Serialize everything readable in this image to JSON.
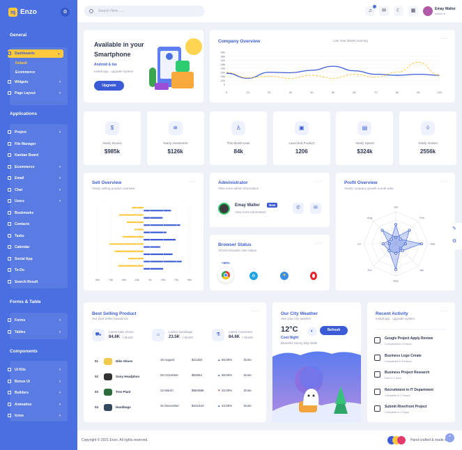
{
  "brand": {
    "mark": "ɱ",
    "name": "Enzo"
  },
  "sidebar": {
    "sections": [
      "General",
      "Applications",
      "Forms & Table",
      "Components"
    ],
    "general": [
      {
        "label": "Dashboards",
        "active": true
      },
      {
        "label": "Widgets"
      },
      {
        "label": "Page Layout"
      }
    ],
    "dash_sub": [
      "Default",
      "Ecommerce"
    ],
    "applications": [
      "Project",
      "File Manager",
      "Kanban Board",
      "Ecommerce",
      "Email",
      "Chat",
      "Users",
      "Bookmarks",
      "Contacts",
      "Tasks",
      "Calendar",
      "Social App",
      "To-Do",
      "Search Result"
    ],
    "forms": [
      "Forms",
      "Tables"
    ],
    "components": [
      "Ui Kits",
      "Bonus Ui",
      "Builders",
      "Animation",
      "Icons"
    ]
  },
  "topbar": {
    "search_placeholder": "Search Here.......",
    "user_name": "Emay Walter",
    "user_role": "Admin ▾"
  },
  "welcome": {
    "title_line1": "Available in your",
    "title_line2": "Smartphone",
    "platforms": "Android & Ios",
    "subtitle": "Install app , upgrade system",
    "button": "Upgrade"
  },
  "company": {
    "title": "Company Overview",
    "legend": "Last Year $300K Earning",
    "more": "···"
  },
  "stats": [
    {
      "label": "Yearly Invoice",
      "value": "$985k",
      "icon": "dollar-icon",
      "glyph": "$"
    },
    {
      "label": "Yearly Investment",
      "value": "$126k",
      "icon": "database-icon",
      "glyph": "≋"
    },
    {
      "label": "This Month User",
      "value": "84k",
      "icon": "user-icon",
      "glyph": "♙"
    },
    {
      "label": "Launched Product",
      "value": "1206",
      "icon": "box-icon",
      "glyph": "▣"
    },
    {
      "label": "Yearly Spend",
      "value": "$324k",
      "icon": "document-icon",
      "glyph": "▤"
    },
    {
      "label": "Yearly Visitors",
      "value": "2556k",
      "icon": "drop-icon",
      "glyph": "◊"
    }
  ],
  "sell": {
    "title": "Sell Overview",
    "subtitle": "Yearly selling product overview"
  },
  "admin": {
    "title": "Administrator",
    "subtitle": "View more admin information",
    "name": "Emay Walter",
    "badge": "New",
    "link": "View more information"
  },
  "browser": {
    "title": "Browser Status",
    "subtitle": "All time browser user status",
    "badge": "+50%"
  },
  "profit": {
    "title": "Profit Overview",
    "subtitle": "Yearly company growth month wise"
  },
  "best": {
    "title": "Best Selling Product",
    "subtitle": "Our best Seller Details list",
    "summary": [
      {
        "label": "Latest Nike shoes",
        "value": "84.6K",
        "unit": "/ Month"
      },
      {
        "label": "Ladies handbags",
        "value": "23.5K",
        "unit": "/ Month"
      },
      {
        "label": "Latest Cosmetics",
        "value": "84.6K",
        "unit": "/ Month"
      }
    ],
    "rows": [
      {
        "no": "01",
        "name": "Nike Shoes",
        "date": "16 August",
        "price": "$21326",
        "pct": "65.00%",
        "up": true,
        "status": "Done"
      },
      {
        "no": "02",
        "name": "Sony Headphon",
        "date": "02 Octomber",
        "price": "$54564",
        "pct": "95.00%",
        "up": true,
        "status": "Done"
      },
      {
        "no": "03",
        "name": "Tree Plant",
        "date": "12 March",
        "price": "$884996",
        "pct": "02.00%",
        "up": false,
        "status": "Done"
      },
      {
        "no": "04",
        "name": "Handbags",
        "date": "31 December",
        "price": "$441623",
        "pct": "43.00%",
        "up": true,
        "status": "Done"
      }
    ]
  },
  "weather": {
    "title": "Our City Weather",
    "subtitle": "See your city weather",
    "temp": "12°C",
    "condition": "Cool Night",
    "desc": "Beautiful Sunny Day Walk",
    "refresh": "Refresh"
  },
  "activity": {
    "title": "Recent Activity",
    "subtitle": "Install app , upgrade system",
    "items": [
      {
        "title": "Google Project Apply Review",
        "time": "Completed in 3 Hours"
      },
      {
        "title": "Business Logo Create",
        "time": "Completed in 5 Hours"
      },
      {
        "title": "Business Project Research",
        "time": "Due in 1 hour"
      },
      {
        "title": "Recruitment in IT Department",
        "time": "Complete in 2 Hours"
      },
      {
        "title": "Submit Riverfront Project",
        "time": "Complete in 2 Days"
      }
    ]
  },
  "footer": {
    "copyright": "Copyright © 2021 Enzo. All rights reserved.",
    "credit": "Hand-crafted & made with ♥"
  },
  "chart_data": [
    {
      "type": "line",
      "x": [
        0,
        10,
        20,
        30,
        40,
        50,
        60,
        70,
        80,
        90,
        100
      ],
      "ylim": [
        0,
        40
      ],
      "yticks": [
        "0",
        "12k",
        "16k",
        "20k",
        "24k",
        "28k",
        "32k",
        "36k",
        "40k"
      ],
      "series": [
        {
          "color": "#3b5bd6",
          "values": [
            19,
            14,
            20,
            19.5,
            22,
            26,
            21.5,
            18,
            17,
            18,
            17
          ]
        },
        {
          "color": "#ffc83d",
          "values": [
            20,
            14.5,
            16,
            14,
            17,
            14,
            18,
            15,
            20,
            30,
            17
          ]
        }
      ]
    },
    {
      "type": "bar",
      "orientation": "horizontal",
      "xticks": [
        "90k",
        "74k",
        "45k",
        "25k",
        "0k",
        "25k",
        "74k",
        "90k"
      ],
      "series": [
        {
          "color": "#ffc83d",
          "values": [
            -15,
            -32,
            -22,
            -12,
            -28,
            -45,
            -38,
            -20,
            -33
          ]
        },
        {
          "color": "#3b5bd6",
          "values": [
            36,
            25,
            48,
            30,
            42,
            22,
            38,
            50,
            26
          ]
        }
      ]
    },
    {
      "type": "radar",
      "axes": [
        "Jan",
        "Feb",
        "Mar",
        "Apr",
        "May",
        "Jun",
        "Jul",
        "Aug"
      ],
      "series": [
        {
          "values": [
            0.2,
            0.6,
            0.3,
            0.2,
            0.8,
            0.3,
            0.2,
            0.6
          ]
        },
        {
          "values": [
            0.6,
            0.2,
            0.8,
            0.3,
            0.3,
            0.3,
            0.4,
            0.2
          ]
        }
      ]
    }
  ]
}
